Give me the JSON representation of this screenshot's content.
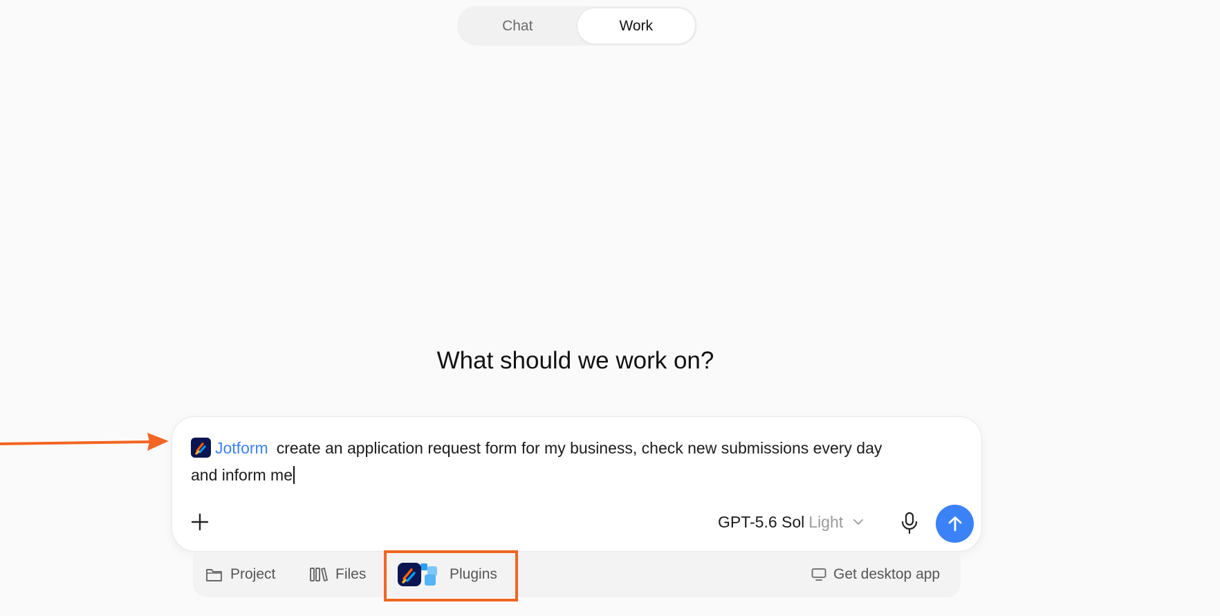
{
  "mode_toggle": {
    "tabs": [
      {
        "label": "Chat",
        "active": false
      },
      {
        "label": "Work",
        "active": true
      }
    ]
  },
  "headline": "What should we work on?",
  "composer": {
    "mention": {
      "label": "Jotform",
      "color": "#3b82f6",
      "icon": "jotform-icon"
    },
    "prompt_line1": "create an application request form for my business, check new submissions every day",
    "prompt_line2": "and inform me",
    "add_icon": "plus-icon",
    "model": {
      "name": "GPT-5.6 Sol",
      "mode": "Light"
    },
    "mic_icon": "microphone-icon",
    "send_icon": "arrow-up-icon",
    "send_color": "#3b82f6"
  },
  "bottom_bar": {
    "project": {
      "label": "Project",
      "icon": "folder-icon"
    },
    "files": {
      "label": "Files",
      "icon": "files-icon"
    },
    "plugins": {
      "label": "Plugins",
      "icon": "plugins-icon"
    },
    "desktop": {
      "label": "Get desktop app",
      "icon": "monitor-icon"
    }
  },
  "annotation": {
    "color": "#f26522"
  }
}
